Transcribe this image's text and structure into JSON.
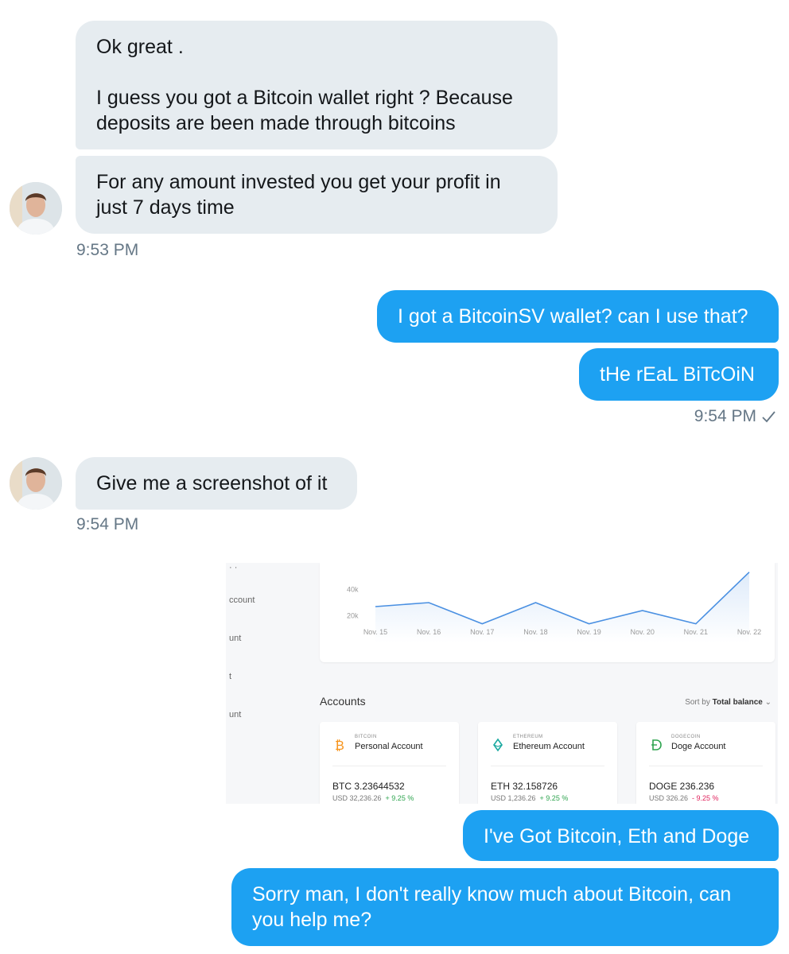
{
  "thread": {
    "incoming_group_1": {
      "bubble_1_paragraphs": [
        "Ok great .",
        "I guess you got a Bitcoin wallet right ? Because deposits are been made through bitcoins"
      ],
      "bubble_2": "For any amount invested you get your profit in just 7 days time",
      "time": "9:53 PM"
    },
    "outgoing_group_1": {
      "bubble_1": "I got a BitcoinSV wallet? can I use that?",
      "bubble_2": "tHe rEaL BiTcOiN",
      "time": "9:54 PM",
      "status_icon": "checkmark-icon"
    },
    "incoming_group_2": {
      "bubble_1": "Give me a screenshot of it",
      "time": "9:54 PM"
    },
    "outgoing_group_2": {
      "bubble_1": "I've Got Bitcoin, Eth and Doge",
      "bubble_2": "Sorry man, I don't really know much about Bitcoin, can you help me?"
    }
  },
  "colors": {
    "incoming_bubble": "#e6ecf0",
    "outgoing_bubble": "#1da1f2",
    "timestamp": "#657786"
  },
  "attached_screenshot": {
    "sidebar_items": [
      "ccount",
      "unt",
      "t",
      "unt"
    ],
    "chart_data": {
      "type": "area",
      "x": [
        "Nov. 15",
        "Nov. 16",
        "Nov. 17",
        "Nov. 18",
        "Nov. 19",
        "Nov. 20",
        "Nov. 21",
        "Nov. 22"
      ],
      "values": [
        27000,
        30000,
        14000,
        30000,
        14000,
        24000,
        14000,
        53000
      ],
      "y_tick_labels": [
        "40k",
        "20k"
      ],
      "ylim": [
        0,
        60000
      ],
      "grid": false,
      "color": "#4a90e2"
    },
    "accounts": {
      "title": "Accounts",
      "sort_prefix": "Sort by",
      "sort_value": "Total balance",
      "cards": [
        {
          "small": "BITCOIN",
          "name": "Personal Account",
          "balance": "BTC 3.23644532",
          "usd": "USD 32,236.26",
          "change": "+ 9.25 %",
          "change_color": "#2ea44f",
          "icon": "bitcoin-icon",
          "icon_color": "#f7931a"
        },
        {
          "small": "ETHEREUM",
          "name": "Ethereum Account",
          "balance": "ETH 32.158726",
          "usd": "USD 1,236.26",
          "change": "+ 9.25 %",
          "change_color": "#2ea44f",
          "icon": "ethereum-icon",
          "icon_color": "#1aa9a0"
        },
        {
          "small": "DOGECOIN",
          "name": "Doge Account",
          "balance": "DOGE 236.236",
          "usd": "USD 326.26",
          "change": "- 9.25 %",
          "change_color": "#e0245e",
          "icon": "dogecoin-icon",
          "icon_color": "#2ea44f"
        }
      ]
    }
  }
}
